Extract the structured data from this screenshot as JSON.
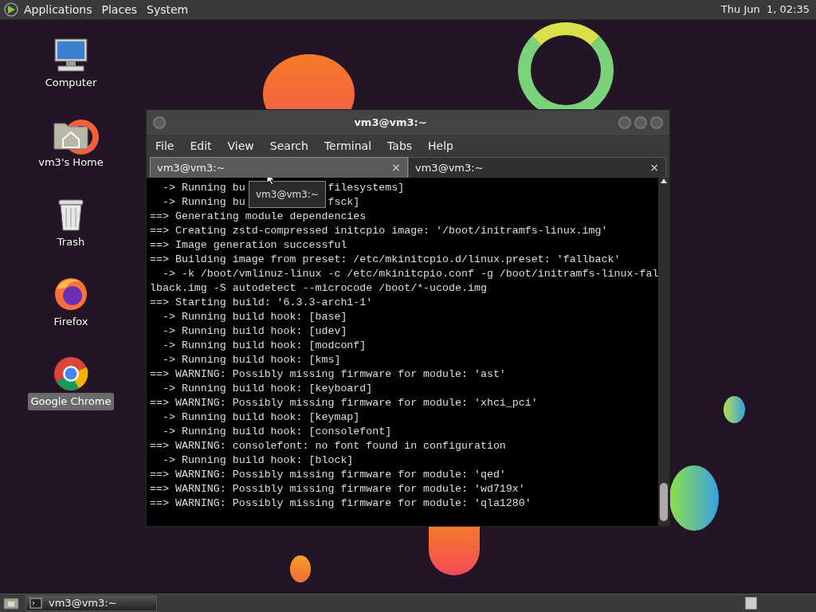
{
  "top_panel": {
    "menus": [
      "Applications",
      "Places",
      "System"
    ],
    "clock": "Thu Jun  1, 02:35"
  },
  "desktop_icons": [
    {
      "label": "Computer",
      "kind": "computer",
      "selected": false
    },
    {
      "label": "vm3's Home",
      "kind": "home",
      "selected": false
    },
    {
      "label": "Trash",
      "kind": "trash",
      "selected": false
    },
    {
      "label": "Firefox",
      "kind": "firefox",
      "selected": false
    },
    {
      "label": "Google Chrome",
      "kind": "chrome",
      "selected": true
    }
  ],
  "window": {
    "title": "vm3@vm3:~",
    "menus": [
      "File",
      "Edit",
      "View",
      "Search",
      "Terminal",
      "Tabs",
      "Help"
    ],
    "tabs": [
      {
        "label": "vm3@vm3:~",
        "close": "×",
        "selected": true
      },
      {
        "label": "vm3@vm3:~",
        "close": "×",
        "selected": false
      }
    ],
    "tooltip": "vm3@vm3:~",
    "lines": [
      {
        "text": "  -> Running bu",
        "rest": "filesystems]"
      },
      {
        "text": "  -> Running bu",
        "rest": "fsck]"
      },
      {
        "text": "==> Generating module dependencies"
      },
      {
        "text": "==> Creating zstd-compressed initcpio image: '/boot/initramfs-linux.img'"
      },
      {
        "text": "==> Image generation successful"
      },
      {
        "text": "==> Building image from preset: /etc/mkinitcpio.d/linux.preset: 'fallback'"
      },
      {
        "text": "  -> -k /boot/vmlinuz-linux -c /etc/mkinitcpio.conf -g /boot/initramfs-linux-fal"
      },
      {
        "text": "lback.img -S autodetect --microcode /boot/*-ucode.img"
      },
      {
        "text": "==> Starting build: '6.3.3-arch1-1'"
      },
      {
        "text": "  -> Running build hook: [base]"
      },
      {
        "text": "  -> Running build hook: [udev]"
      },
      {
        "text": "  -> Running build hook: [modconf]"
      },
      {
        "text": "  -> Running build hook: [kms]"
      },
      {
        "text": "==> WARNING: Possibly missing firmware for module: 'ast'"
      },
      {
        "text": "  -> Running build hook: [keyboard]"
      },
      {
        "text": "==> WARNING: Possibly missing firmware for module: 'xhci_pci'"
      },
      {
        "text": "  -> Running build hook: [keymap]"
      },
      {
        "text": "  -> Running build hook: [consolefont]"
      },
      {
        "text": "==> WARNING: consolefont: no font found in configuration"
      },
      {
        "text": "  -> Running build hook: [block]"
      },
      {
        "text": "==> WARNING: Possibly missing firmware for module: 'qed'"
      },
      {
        "text": "==> WARNING: Possibly missing firmware for module: 'wd719x'"
      },
      {
        "text": "==> WARNING: Possibly missing firmware for module: 'qla1280'"
      }
    ]
  },
  "taskbar": {
    "tasks": [
      {
        "label": "vm3@vm3:~",
        "selected": true
      }
    ]
  }
}
